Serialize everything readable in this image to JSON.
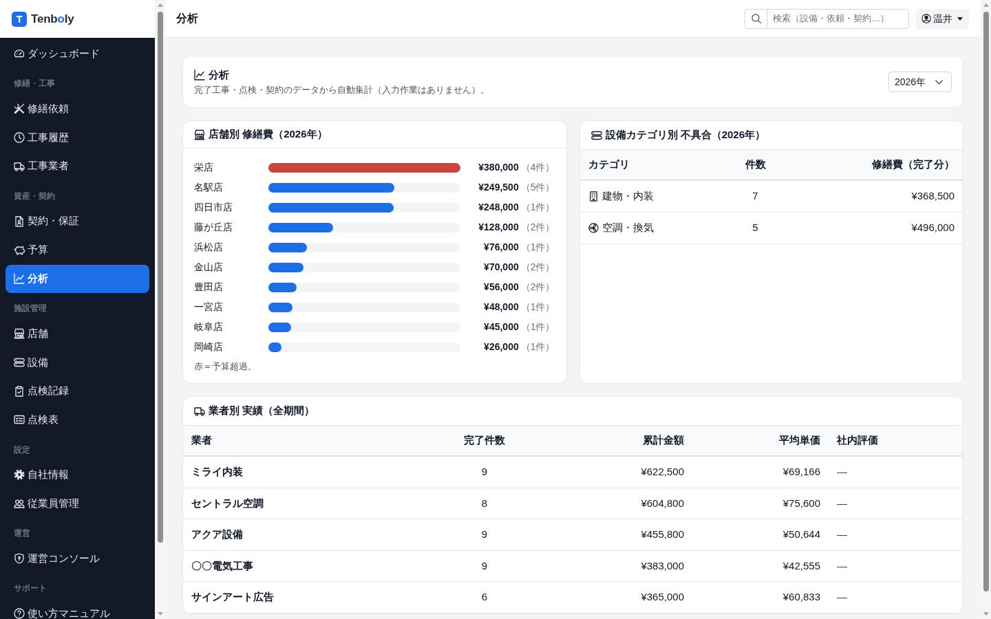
{
  "brand": {
    "mark": "T",
    "name_parts": [
      {
        "text": "Tenb",
        "accent": false
      },
      {
        "text": "o",
        "accent": true
      },
      {
        "text": "ly",
        "accent": false
      }
    ]
  },
  "sidebar": {
    "sections": [
      {
        "items": [
          {
            "label": "ダッシュボード",
            "selected": false
          }
        ]
      },
      {
        "label": "修繕・工事",
        "items": [
          {
            "label": "修繕依頼",
            "selected": false
          },
          {
            "label": "工事履歴",
            "selected": false
          },
          {
            "label": "工事業者",
            "selected": false
          }
        ]
      },
      {
        "label": "資産・契約",
        "items": [
          {
            "label": "契約・保証",
            "selected": false
          },
          {
            "label": "予算",
            "selected": false
          },
          {
            "label": "分析",
            "selected": true
          }
        ]
      },
      {
        "label": "施設管理",
        "items": [
          {
            "label": "店舗",
            "selected": false
          },
          {
            "label": "設備",
            "selected": false
          },
          {
            "label": "点検記録",
            "selected": false
          },
          {
            "label": "点検表",
            "selected": false
          }
        ]
      },
      {
        "label": "設定",
        "items": [
          {
            "label": "自社情報",
            "selected": false
          },
          {
            "label": "従業員管理",
            "selected": false
          }
        ]
      },
      {
        "label": "運営",
        "items": [
          {
            "label": "運営コンソール",
            "selected": false
          }
        ]
      },
      {
        "label": "サポート",
        "items": [
          {
            "label": "使い方マニュアル",
            "selected": false
          }
        ]
      }
    ]
  },
  "header": {
    "title": "分析",
    "search": {
      "placeholder": "検索（設備・依頼・契約…）"
    },
    "user": {
      "name": "温井"
    }
  },
  "overview": {
    "title": "分析",
    "subtitle": "完了工事・点検・契約のデータから自動集計（入力作業はありません）。",
    "year_select": {
      "value": "2026年"
    }
  },
  "store_costs": {
    "title": "店舗別 修繕費（2026年）",
    "rows": [
      {
        "store": "栄店",
        "level": 1,
        "amount": "¥380,000",
        "count": "（4件）",
        "over_budget": true
      },
      {
        "store": "名駅店",
        "level": 0.657,
        "amount": "¥249,500",
        "count": "（5件）",
        "over_budget": false
      },
      {
        "store": "四日市店",
        "level": 0.653,
        "amount": "¥248,000",
        "count": "（1件）",
        "over_budget": false
      },
      {
        "store": "藤が丘店",
        "level": 0.337,
        "amount": "¥128,000",
        "count": "（2件）",
        "over_budget": false
      },
      {
        "store": "浜松店",
        "level": 0.2,
        "amount": "¥76,000",
        "count": "（1件）",
        "over_budget": false
      },
      {
        "store": "金山店",
        "level": 0.184,
        "amount": "¥70,000",
        "count": "（2件）",
        "over_budget": false
      },
      {
        "store": "豊田店",
        "level": 0.147,
        "amount": "¥56,000",
        "count": "（2件）",
        "over_budget": false
      },
      {
        "store": "一宮店",
        "level": 0.126,
        "amount": "¥48,000",
        "count": "（1件）",
        "over_budget": false
      },
      {
        "store": "岐阜店",
        "level": 0.118,
        "amount": "¥45,000",
        "count": "（1件）",
        "over_budget": false
      },
      {
        "store": "岡崎店",
        "level": 0.068,
        "amount": "¥26,000",
        "count": "（1件）",
        "over_budget": false
      }
    ],
    "note": "赤＝予算超過。"
  },
  "category_issues": {
    "title": "設備カテゴリ別 不具合（2026年）",
    "columns": [
      "カテゴリ",
      "件数",
      "修繕費（完了分）"
    ],
    "rows": [
      {
        "category": "建物・内装",
        "count": "7",
        "cost": "¥368,500"
      },
      {
        "category": "空調・換気",
        "count": "5",
        "cost": "¥496,000"
      }
    ]
  },
  "vendor_performance": {
    "title": "業者別 実績（全期間）",
    "columns": [
      "業者",
      "完了件数",
      "累計金額",
      "平均単価",
      "社内評価"
    ],
    "rows": [
      {
        "vendor": "ミライ内装",
        "completed": "9",
        "total": "¥622,500",
        "average": "¥69,166",
        "rating": "—"
      },
      {
        "vendor": "セントラル空調",
        "completed": "8",
        "total": "¥604,800",
        "average": "¥75,600",
        "rating": "—"
      },
      {
        "vendor": "アクア設備",
        "completed": "9",
        "total": "¥455,800",
        "average": "¥50,644",
        "rating": "—"
      },
      {
        "vendor": "〇〇電気工事",
        "completed": "9",
        "total": "¥383,000",
        "average": "¥42,555",
        "rating": "—"
      },
      {
        "vendor": "サインアート広告",
        "completed": "6",
        "total": "¥365,000",
        "average": "¥60,833",
        "rating": "—"
      }
    ]
  }
}
